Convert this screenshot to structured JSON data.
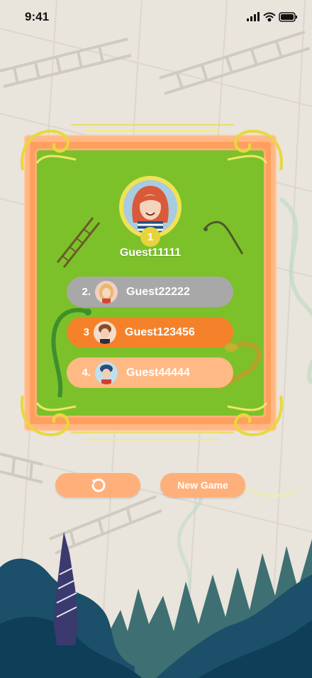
{
  "status_bar": {
    "time": "9:41"
  },
  "results": {
    "winner": {
      "rank": "1",
      "name": "Guest11111"
    },
    "rows": [
      {
        "rank": "2.",
        "name": "Guest22222",
        "color": "#a8a8a8"
      },
      {
        "rank": "3",
        "name": "Guest123456",
        "color": "#f5822a"
      },
      {
        "rank": "4.",
        "name": "Guest44444",
        "color": "#ffb985"
      }
    ]
  },
  "actions": {
    "restart_icon": "restart-icon",
    "new_game_label": "New Game"
  },
  "colors": {
    "board": "#7cc12a",
    "frame": "#ffb784",
    "accent_gold": "#e8d33a",
    "button": "#ffb07a"
  }
}
